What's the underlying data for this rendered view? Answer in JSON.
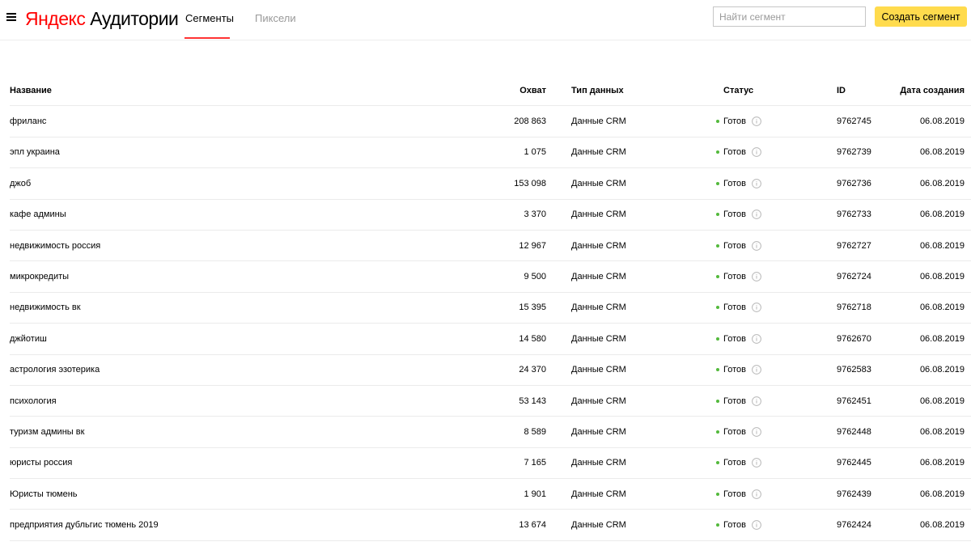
{
  "header": {
    "logo_brand": "Яндекс",
    "logo_product": "Аудитории",
    "tabs": [
      {
        "label": "Сегменты",
        "active": true
      },
      {
        "label": "Пиксели",
        "active": false
      }
    ],
    "search": {
      "placeholder": "Найти сегмент",
      "value": ""
    },
    "create_button_label": "Создать сегмент",
    "accent_color": "#ffdb4d",
    "tab_active_color": "#ff3333"
  },
  "table": {
    "columns": {
      "name": "Название",
      "reach": "Охват",
      "type": "Тип данных",
      "status": "Статус",
      "id": "ID",
      "date": "Дата создания"
    },
    "status_color": "#53b93c",
    "rows": [
      {
        "name": "фриланс",
        "reach": "208 863",
        "type": "Данные CRM",
        "status": "Готов",
        "id": "9762745",
        "date": "06.08.2019"
      },
      {
        "name": "эпл украина",
        "reach": "1 075",
        "type": "Данные CRM",
        "status": "Готов",
        "id": "9762739",
        "date": "06.08.2019"
      },
      {
        "name": "джоб",
        "reach": "153 098",
        "type": "Данные CRM",
        "status": "Готов",
        "id": "9762736",
        "date": "06.08.2019"
      },
      {
        "name": "кафе админы",
        "reach": "3 370",
        "type": "Данные CRM",
        "status": "Готов",
        "id": "9762733",
        "date": "06.08.2019"
      },
      {
        "name": "недвижимость россия",
        "reach": "12 967",
        "type": "Данные CRM",
        "status": "Готов",
        "id": "9762727",
        "date": "06.08.2019"
      },
      {
        "name": "микрокредиты",
        "reach": "9 500",
        "type": "Данные CRM",
        "status": "Готов",
        "id": "9762724",
        "date": "06.08.2019"
      },
      {
        "name": "недвижимость вк",
        "reach": "15 395",
        "type": "Данные CRM",
        "status": "Готов",
        "id": "9762718",
        "date": "06.08.2019"
      },
      {
        "name": "джйотиш",
        "reach": "14 580",
        "type": "Данные CRM",
        "status": "Готов",
        "id": "9762670",
        "date": "06.08.2019"
      },
      {
        "name": "астрология эзотерика",
        "reach": "24 370",
        "type": "Данные CRM",
        "status": "Готов",
        "id": "9762583",
        "date": "06.08.2019"
      },
      {
        "name": "психология",
        "reach": "53 143",
        "type": "Данные CRM",
        "status": "Готов",
        "id": "9762451",
        "date": "06.08.2019"
      },
      {
        "name": "туризм админы вк",
        "reach": "8 589",
        "type": "Данные CRM",
        "status": "Готов",
        "id": "9762448",
        "date": "06.08.2019"
      },
      {
        "name": "юристы россия",
        "reach": "7 165",
        "type": "Данные CRM",
        "status": "Готов",
        "id": "9762445",
        "date": "06.08.2019"
      },
      {
        "name": "Юристы тюмень",
        "reach": "1 901",
        "type": "Данные CRM",
        "status": "Готов",
        "id": "9762439",
        "date": "06.08.2019"
      },
      {
        "name": "предприятия дубльгис тюмень 2019",
        "reach": "13 674",
        "type": "Данные CRM",
        "status": "Готов",
        "id": "9762424",
        "date": "06.08.2019"
      }
    ]
  }
}
